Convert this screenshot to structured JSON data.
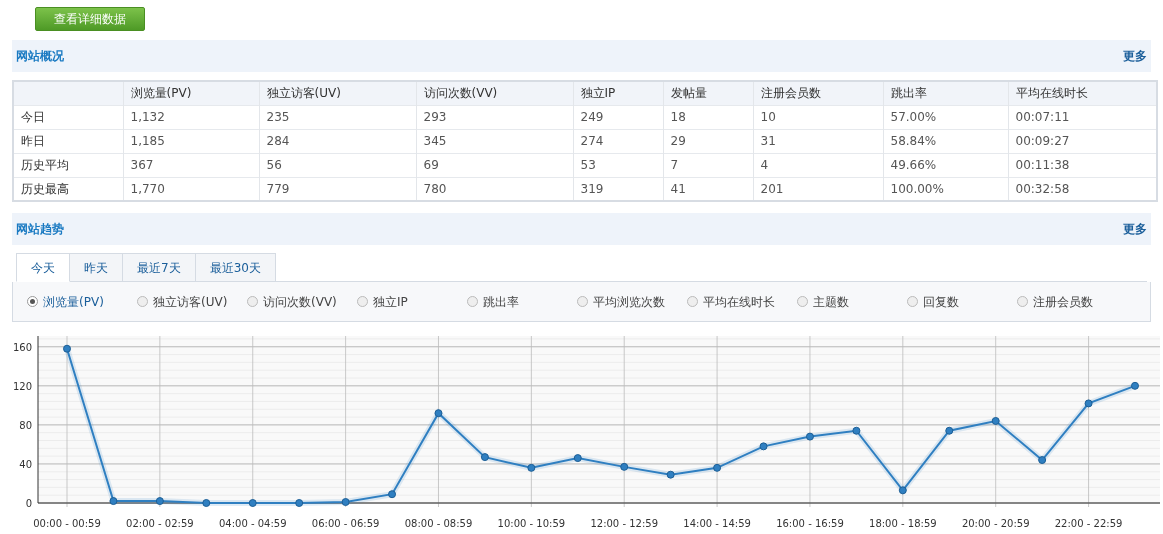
{
  "detail_button": "查看详细数据",
  "overview": {
    "title": "网站概况",
    "more": "更多",
    "columns": [
      "",
      "浏览量(PV)",
      "独立访客(UV)",
      "访问次数(VV)",
      "独立IP",
      "发帖量",
      "注册会员数",
      "跳出率",
      "平均在线时长"
    ],
    "rows": [
      [
        "今日",
        "1,132",
        "235",
        "293",
        "249",
        "18",
        "10",
        "57.00%",
        "00:07:11"
      ],
      [
        "昨日",
        "1,185",
        "284",
        "345",
        "274",
        "29",
        "31",
        "58.84%",
        "00:09:27"
      ],
      [
        "历史平均",
        "367",
        "56",
        "69",
        "53",
        "7",
        "4",
        "49.66%",
        "00:11:38"
      ],
      [
        "历史最高",
        "1,770",
        "779",
        "780",
        "319",
        "41",
        "201",
        "100.00%",
        "00:32:58"
      ]
    ]
  },
  "trend": {
    "title": "网站趋势",
    "more": "更多",
    "tabs": [
      {
        "label": "今天",
        "selected": true
      },
      {
        "label": "昨天",
        "selected": false
      },
      {
        "label": "最近7天",
        "selected": false
      },
      {
        "label": "最近30天",
        "selected": false
      }
    ],
    "metrics": [
      {
        "label": "浏览量(PV)",
        "selected": true
      },
      {
        "label": "独立访客(UV)",
        "selected": false
      },
      {
        "label": "访问次数(VV)",
        "selected": false
      },
      {
        "label": "独立IP",
        "selected": false
      },
      {
        "label": "跳出率",
        "selected": false
      },
      {
        "label": "平均浏览次数",
        "selected": false
      },
      {
        "label": "平均在线时长",
        "selected": false
      },
      {
        "label": "主题数",
        "selected": false
      },
      {
        "label": "回复数",
        "selected": false
      },
      {
        "label": "注册会员数",
        "selected": false
      }
    ],
    "chart_data": {
      "type": "line",
      "categories": [
        "00:00 - 00:59",
        null,
        "02:00 - 02:59",
        null,
        "04:00 - 04:59",
        null,
        "06:00 - 06:59",
        null,
        "08:00 - 08:59",
        null,
        "10:00 - 10:59",
        null,
        "12:00 - 12:59",
        null,
        "14:00 - 14:59",
        null,
        "16:00 - 16:59",
        null,
        "18:00 - 18:59",
        null,
        "20:00 - 20:59",
        null,
        "22:00 - 22:59",
        null
      ],
      "grid": true,
      "series": [
        {
          "color": "#2f7fc1",
          "marker": "circle",
          "values": [
            158,
            2,
            2,
            0,
            0,
            0,
            1,
            9,
            92,
            47,
            36,
            46,
            37,
            29,
            36,
            58,
            68,
            74,
            13,
            74,
            84,
            44,
            102,
            120
          ]
        }
      ],
      "ylim": [
        0,
        170
      ],
      "yticks": [
        0,
        40,
        80,
        120,
        160
      ]
    }
  }
}
